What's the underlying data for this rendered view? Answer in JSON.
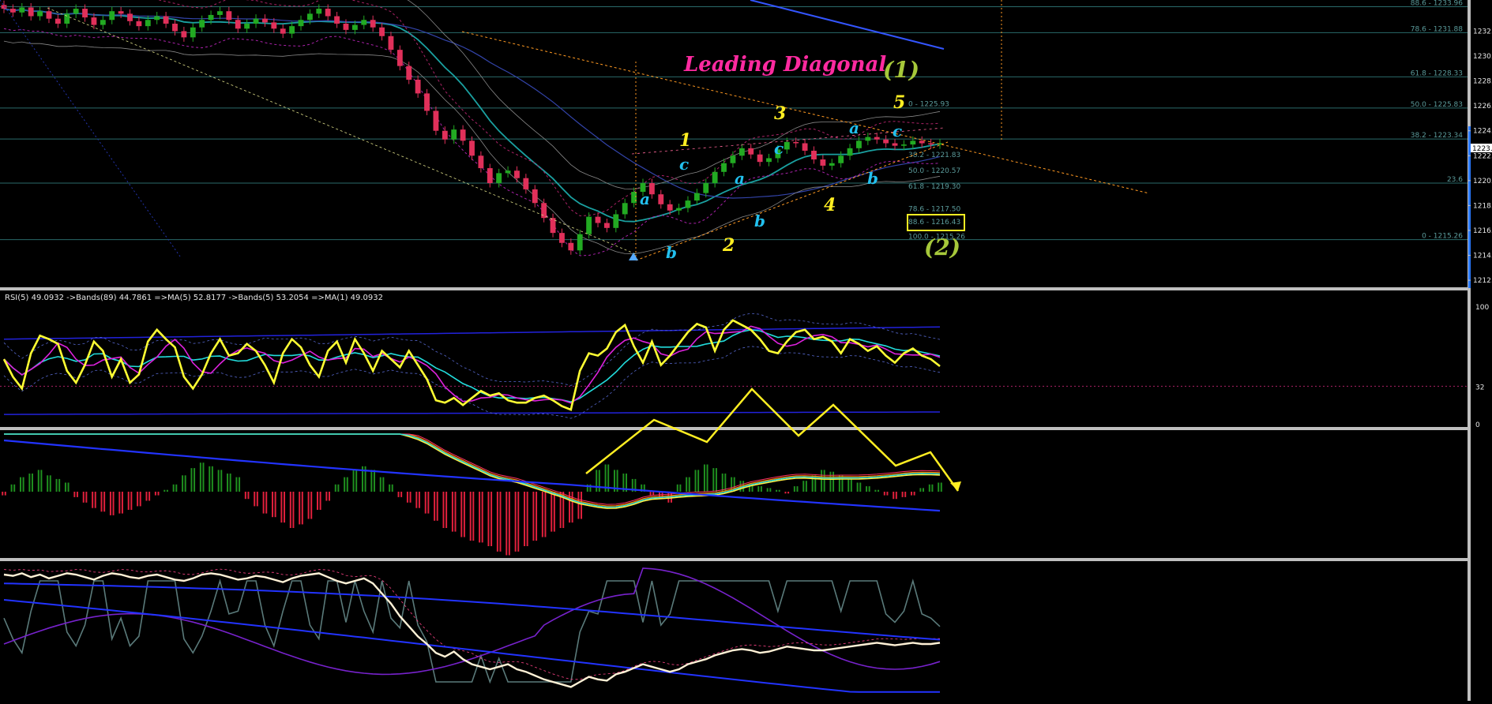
{
  "colors": {
    "bg": "#000000",
    "up_candle": "#22aa22",
    "down_candle": "#e0305a",
    "rsi_line": "#ffff33",
    "rsi_ma": "#22dddd",
    "rsi_ma2": "#dd22dd",
    "band": "#2222dd",
    "hist_up": "#1f8f1f",
    "hist_down": "#e0203c",
    "fib_line": "#2a6a6a",
    "label_pink": "#ff2aa0",
    "label_yellow": "#ffee22",
    "label_cyan": "#22c0ee",
    "label_green": "#a6c83a"
  },
  "annotations": {
    "title": "Leading Diagonal",
    "wave_1_big": "(1)",
    "wave_2_big": "(2)",
    "w1": "1",
    "w2": "2",
    "w3": "3",
    "w4": "4",
    "w5": "5",
    "sub_a1": "a",
    "sub_b1": "b",
    "sub_c1": "c",
    "sub_a2": "a",
    "sub_b2": "b",
    "sub_c2": "c",
    "sub_a3": "a",
    "sub_b3": "b",
    "sub_c3": "c"
  },
  "fib_labels": [
    {
      "text": "88.6 - 1233.96"
    },
    {
      "text": "78.6 - 1231.88"
    },
    {
      "text": "61.8 - 1228.33"
    },
    {
      "text": "50.0 - 1225.83"
    },
    {
      "text": "38.2 - 1223.34"
    },
    {
      "text": "23.6"
    },
    {
      "text": "0 - 1215.26"
    }
  ],
  "inner_fib_labels": [
    {
      "text": "0 - 1225.93"
    },
    {
      "text": "38.2 - 1221.83"
    },
    {
      "text": "50.0 - 1220.57"
    },
    {
      "text": "61.8 - 1219.30"
    },
    {
      "text": "78.6 - 1217.50"
    },
    {
      "text": "88.6 - 1216.43"
    },
    {
      "text": "100.0 - 1215.26"
    }
  ],
  "rsi_header": "RSI(5) 49.0932  ->Bands(89) 44.7861  =>MA(5) 52.8177  ->Bands(5) 53.2054  =>MA(1) 49.0932",
  "current_price": "1223.",
  "chart_data": [
    {
      "type": "line",
      "panel": "price",
      "yaxis_ticks": [
        "1232.",
        "1230.",
        "1228.",
        "1226.",
        "1224.",
        "1222.",
        "1220.",
        "1218.",
        "1216.",
        "1214.",
        "1212."
      ],
      "ylim": [
        1211.5,
        1234.5
      ],
      "close_series": [
        1233.8,
        1233.5,
        1233.9,
        1233.2,
        1233.6,
        1233.0,
        1232.6,
        1233.4,
        1233.8,
        1233.1,
        1232.5,
        1232.9,
        1233.6,
        1233.4,
        1232.8,
        1232.4,
        1232.9,
        1233.2,
        1232.6,
        1232.0,
        1231.5,
        1232.3,
        1232.9,
        1233.3,
        1233.6,
        1232.9,
        1232.2,
        1232.6,
        1233.0,
        1232.7,
        1232.2,
        1231.8,
        1232.4,
        1232.9,
        1233.4,
        1233.8,
        1233.2,
        1232.6,
        1232.1,
        1232.5,
        1232.9,
        1232.3,
        1231.6,
        1230.5,
        1229.2,
        1228.1,
        1227.0,
        1225.6,
        1224.0,
        1223.3,
        1224.1,
        1223.2,
        1222.0,
        1221.0,
        1219.8,
        1220.6,
        1220.8,
        1220.2,
        1219.3,
        1218.2,
        1217.0,
        1215.8,
        1215.0,
        1214.4,
        1215.7,
        1217.1,
        1216.6,
        1216.2,
        1217.3,
        1218.2,
        1219.1,
        1219.8,
        1218.9,
        1218.1,
        1217.6,
        1217.8,
        1218.4,
        1219.0,
        1219.8,
        1220.7,
        1221.4,
        1222.0,
        1222.6,
        1222.1,
        1221.5,
        1221.8,
        1222.5,
        1223.1,
        1223.0,
        1222.4,
        1221.7,
        1221.2,
        1221.4,
        1222.0,
        1222.6,
        1223.2,
        1223.5,
        1223.3,
        1223.0,
        1222.8,
        1222.9,
        1223.2,
        1223.0,
        1222.9,
        1223.0
      ],
      "wave_labels": [
        "1",
        "2",
        "3",
        "4",
        "5",
        "(1)",
        "(2)"
      ]
    },
    {
      "type": "line",
      "panel": "rsi",
      "yaxis_ticks": [
        "100",
        "32",
        "0"
      ],
      "ylim": [
        0,
        100
      ],
      "series": [
        {
          "values": [
            55,
            40,
            30,
            60,
            75,
            72,
            68,
            45,
            35,
            50,
            70,
            62,
            40,
            55,
            35,
            42,
            70,
            80,
            72,
            65,
            40,
            30,
            42,
            60,
            72,
            58,
            60,
            68,
            62,
            50,
            35,
            60,
            72,
            65,
            50,
            40,
            62,
            70,
            52,
            72,
            60,
            45,
            62,
            55,
            48,
            62,
            50,
            38,
            20,
            18,
            22,
            16,
            22,
            28,
            24,
            26,
            20,
            18,
            18,
            22,
            24,
            20,
            15,
            12,
            45,
            60,
            58,
            64,
            78,
            84,
            66,
            52,
            70,
            50,
            58,
            68,
            78,
            85,
            82,
            62,
            80,
            88,
            84,
            80,
            72,
            62,
            60,
            70,
            78,
            80,
            72,
            74,
            70,
            60,
            72,
            68,
            62,
            66,
            58,
            52,
            60,
            64,
            58,
            55,
            49
          ]
        }
      ]
    },
    {
      "type": "bar",
      "panel": "macd",
      "series": [
        {
          "values": [
            -2,
            4,
            8,
            10,
            12,
            9,
            7,
            5,
            -3,
            -6,
            -9,
            -11,
            -13,
            -12,
            -10,
            -8,
            -5,
            -2,
            1,
            4,
            9,
            13,
            16,
            14,
            12,
            10,
            8,
            -4,
            -8,
            -12,
            -14,
            -17,
            -20,
            -18,
            -15,
            -10,
            -5,
            4,
            8,
            12,
            14,
            12,
            8,
            4,
            -3,
            -6,
            -9,
            -12,
            -16,
            -20,
            -22,
            -25,
            -27,
            -28,
            -30,
            -33,
            -35,
            -33,
            -30,
            -27,
            -25,
            -22,
            -20,
            -17,
            -15,
            4,
            12,
            15,
            12,
            10,
            7,
            4,
            -2,
            -4,
            -6,
            4,
            8,
            12,
            15,
            13,
            10,
            8,
            6,
            4,
            3,
            2,
            1,
            -1,
            3,
            6,
            9,
            12,
            11,
            9,
            7,
            5,
            3,
            1,
            -2,
            -4,
            -3,
            -2,
            2,
            4,
            5
          ]
        }
      ]
    },
    {
      "type": "line",
      "panel": "stochastic",
      "series": [
        {
          "values": [
            95,
            94,
            96,
            93,
            95,
            92,
            94,
            96,
            95,
            93,
            91,
            94,
            96,
            95,
            93,
            92,
            94,
            95,
            93,
            91,
            90,
            92,
            95,
            96,
            95,
            93,
            91,
            92,
            94,
            93,
            91,
            89,
            92,
            94,
            95,
            96,
            93,
            90,
            88,
            90,
            92,
            88,
            80,
            72,
            62,
            54,
            46,
            40,
            33,
            30,
            34,
            28,
            24,
            22,
            20,
            22,
            24,
            20,
            18,
            15,
            12,
            10,
            8,
            6,
            10,
            14,
            12,
            11,
            16,
            18,
            21,
            24,
            22,
            20,
            18,
            20,
            24,
            26,
            28,
            31,
            33,
            35,
            36,
            35,
            33,
            34,
            36,
            38,
            37,
            36,
            35,
            35,
            36,
            37,
            38,
            39,
            40,
            41,
            40,
            39,
            40,
            41,
            40,
            40,
            41
          ]
        }
      ]
    }
  ]
}
